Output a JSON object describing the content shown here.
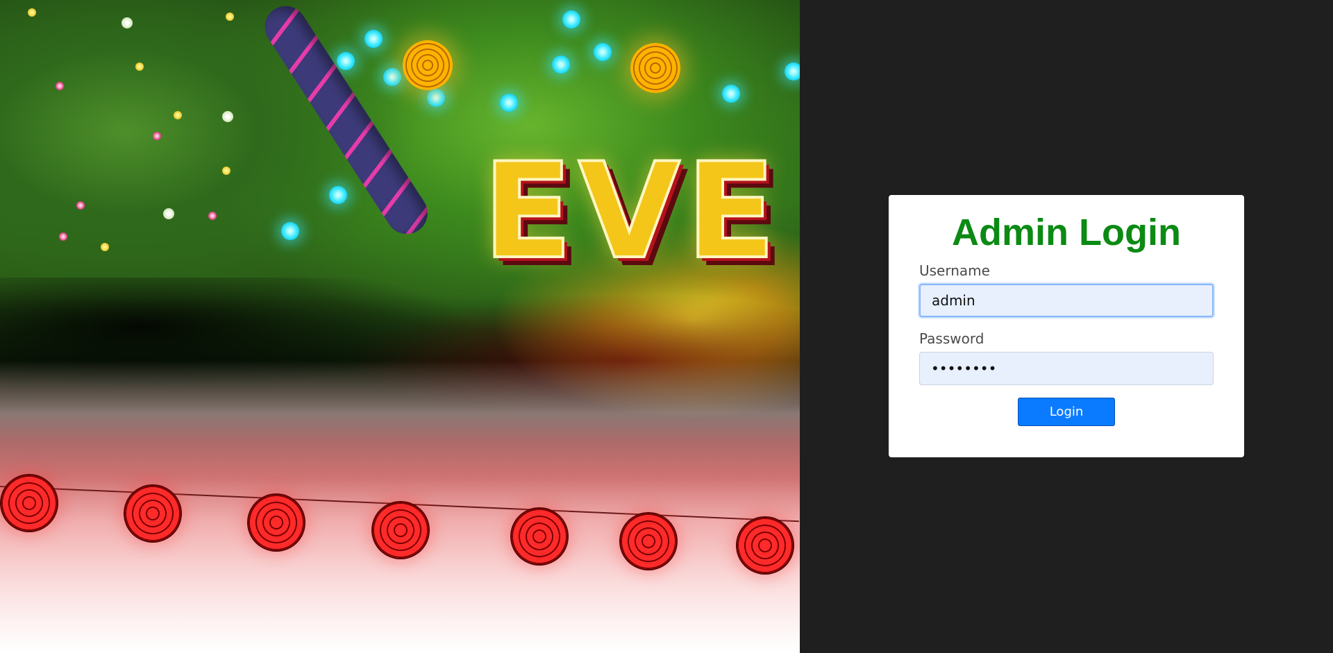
{
  "hero": {
    "sign_text": "EVE"
  },
  "login": {
    "title": "Admin Login",
    "username_label": "Username",
    "username_value": "admin",
    "password_label": "Password",
    "password_value": "password",
    "button_label": "Login"
  },
  "colors": {
    "title": "#0b8a14",
    "button": "#0a7bff",
    "panel_bg": "#1f1f1f",
    "input_bg": "#e8f0fe"
  }
}
